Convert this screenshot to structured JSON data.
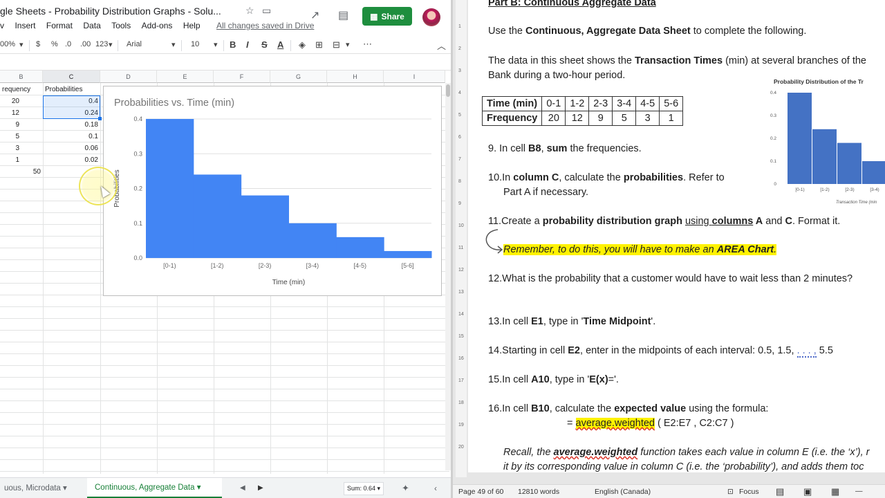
{
  "sheets": {
    "title": "gle Sheets - Probability Distribution Graphs - Solu...",
    "menu": [
      "v",
      "Insert",
      "Format",
      "Data",
      "Tools",
      "Add-ons",
      "Help"
    ],
    "saved_status": "All changes saved in Drive",
    "share_label": "Share",
    "toolbar": {
      "zoom": "00%",
      "currency": "$",
      "percent": "%",
      "dec_dec": ".0",
      "inc_dec": ".00",
      "more_formats": "123",
      "font": "Arial",
      "font_size": "10",
      "bold": "B",
      "italic": "I",
      "strike": "S",
      "text_color": "A"
    },
    "columns": [
      "B",
      "C",
      "D",
      "E",
      "F",
      "G",
      "H",
      "I"
    ],
    "header_row": [
      "requency",
      "Probabilities"
    ],
    "rows": [
      [
        "20",
        "0.4"
      ],
      [
        "12",
        "0.24"
      ],
      [
        "9",
        "0.18"
      ],
      [
        "5",
        "0.1"
      ],
      [
        "3",
        "0.06"
      ],
      [
        "1",
        "0.02"
      ],
      [
        "50",
        ""
      ]
    ],
    "tabs": [
      "uous, Microdata",
      "Continuous, Aggregate Data"
    ],
    "sum_label": "Sum: 0.64",
    "accent": "#1e8e3e"
  },
  "chart_data": {
    "type": "area",
    "title": "Probabilities vs. Time (min)",
    "xlabel": "Time (min)",
    "ylabel": "Probabilities",
    "categories": [
      "[0-1)",
      "[1-2)",
      "[2-3)",
      "[3-4)",
      "[4-5)",
      "[5-6]"
    ],
    "values": [
      0.4,
      0.24,
      0.18,
      0.1,
      0.06,
      0.02
    ],
    "ylim": [
      0,
      0.4
    ],
    "yticks": [
      "0.0",
      "0.1",
      "0.2",
      "0.3",
      "0.4"
    ],
    "color": "#4285f4",
    "grid": true
  },
  "word": {
    "heading": "Part B: Continuous Aggregate Data",
    "intro_1": "Use the ",
    "intro_1b": "Continuous, Aggregate Data Sheet",
    "intro_1c": " to complete the following.",
    "intro_2a": "The data in this sheet shows the ",
    "intro_2b": "Transaction Times",
    "intro_2c": " (min) at several branches of the",
    "intro_3": "Bank during a two-hour period.",
    "table": {
      "row1_label": "Time (min)",
      "row2_label": "Frequency",
      "times": [
        "0-1",
        "1-2",
        "2-3",
        "3-4",
        "4-5",
        "5-6"
      ],
      "freqs": [
        "20",
        "12",
        "9",
        "5",
        "3",
        "1"
      ]
    },
    "mini_chart": {
      "title": "Probability Distribution of the Tr",
      "yticks": [
        "0.4",
        "0.3",
        "0.2",
        "0.1",
        "0"
      ],
      "ylabel": "Probability",
      "xlabel": "Transaction Time (min",
      "categories": [
        "[0-1)",
        "[1-2)",
        "[2-3)",
        "[3-4)"
      ],
      "values": [
        0.4,
        0.24,
        0.18,
        0.1
      ]
    },
    "q9a": "9.   In cell ",
    "q9b": "B8",
    "q9c": ", ",
    "q9d": "sum",
    "q9e": " the frequencies.",
    "q10a": "10.In ",
    "q10b": "column C",
    "q10c": ", calculate the ",
    "q10d": "probabilities",
    "q10e": ".  Refer to",
    "q10f": "Part A if necessary.",
    "q11a": "11.Create a ",
    "q11b": "probability distribution graph",
    "q11c": " ",
    "q11d": "using",
    "q11e": "  ",
    "q11f": "columns",
    "q11g": " A",
    "q11h": " and ",
    "q11i": "C",
    "q11j": ".  Format it.",
    "remember_a": "Remember, to do this, you will have to make an ",
    "remember_b": "AREA Chart",
    "remember_c": ".",
    "q12": "12.What is the probability that a customer would have to wait less than 2 minutes?",
    "q13a": "13.In cell ",
    "q13b": "E1",
    "q13c": ", type in '",
    "q13d": "Time Midpoint",
    "q13e": "'.",
    "q14a": "14.Starting in cell ",
    "q14b": "E2",
    "q14c": ", enter in the midpoints of each interval:  0.5, 1.5, ",
    "q14d": ". . . ,",
    "q14e": " 5.5",
    "q15a": "15.In cell ",
    "q15b": "A10",
    "q15c": ", type in '",
    "q15d": "E(x)",
    "q15e": "='.",
    "q16a": "16.In cell ",
    "q16b": "B10",
    "q16c": ", calculate the ",
    "q16d": "expected value",
    "q16e": " using the formula:",
    "formula_a": "= ",
    "formula_b": "average.weighted",
    "formula_c": " ( E2:E7 , C2:C7 )",
    "recall_1a": "Recall, the ",
    "recall_1b": "average.weighted",
    "recall_1c": " function takes each value in column E (i.e. the ‘x’), r",
    "recall_2": "it by its corresponding value in column C (i.e. the ‘probability’), and adds them toc",
    "ruler_marks": [
      "1",
      "2",
      "3",
      "4",
      "5",
      "6",
      "7",
      "8",
      "9",
      "10",
      "11",
      "12",
      "13",
      "14",
      "15",
      "16",
      "17",
      "18",
      "19",
      "20"
    ],
    "status": {
      "page": "Page 49 of 60",
      "words": "12810 words",
      "lang": "English (Canada)",
      "focus": "Focus"
    }
  }
}
